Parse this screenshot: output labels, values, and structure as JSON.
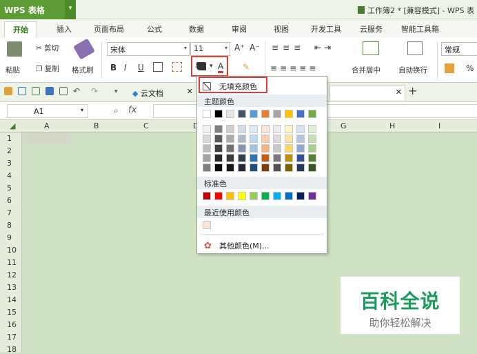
{
  "app": {
    "name": "WPS 表格",
    "doc_title": "工作簿2 * [兼容模式] - WPS 表"
  },
  "tabs": [
    "开始",
    "插入",
    "页面布局",
    "公式",
    "数据",
    "审阅",
    "视图",
    "开发工具",
    "云服务",
    "智能工具箱"
  ],
  "ribbon": {
    "paste": "粘贴",
    "cut": "剪切",
    "copy": "复制",
    "format_painter": "格式刷",
    "font_name": "宋体",
    "font_size": "11",
    "bold": "B",
    "italic": "I",
    "underline": "U",
    "grow_font": "A⁺",
    "shrink_font": "A⁻",
    "merge_center": "合并居中",
    "wrap_text": "自动换行",
    "number_format": "常规",
    "percent": "%"
  },
  "qat": {
    "tab_name": "云文档"
  },
  "formula": {
    "cell_ref": "A1",
    "fx": "fx"
  },
  "columns": [
    "A",
    "B",
    "C",
    "D",
    "E",
    "F",
    "G",
    "H",
    "I"
  ],
  "rows": [
    "1",
    "2",
    "3",
    "4",
    "5",
    "6",
    "7",
    "8",
    "9",
    "10",
    "11",
    "12",
    "13",
    "14",
    "15",
    "16",
    "17",
    "18"
  ],
  "fill_menu": {
    "no_fill": "无填充颜色",
    "theme_colors_label": "主题颜色",
    "standard_colors_label": "标准色",
    "recent_colors_label": "最近使用颜色",
    "more_colors": "其他颜色(M)...",
    "theme_top": [
      "#ffffff",
      "#000000",
      "#e7e6e6",
      "#44546a",
      "#5b9bd5",
      "#ed7d31",
      "#a5a5a5",
      "#ffc000",
      "#4472c4",
      "#70ad47"
    ],
    "theme_shades": [
      [
        "#f2f2f2",
        "#7f7f7f",
        "#d0cece",
        "#d6dce4",
        "#deebf6",
        "#fbe5d5",
        "#ededed",
        "#fff2cc",
        "#d9e2f3",
        "#e2efd9"
      ],
      [
        "#d8d8d8",
        "#595959",
        "#aeaaaa",
        "#adb9ca",
        "#bdd7ee",
        "#f7cbac",
        "#dbdbdb",
        "#fee599",
        "#b4c6e7",
        "#c5e0b3"
      ],
      [
        "#bfbfbf",
        "#3f3f3f",
        "#757070",
        "#8496b0",
        "#9dc3e6",
        "#f4b183",
        "#c9c9c9",
        "#ffd965",
        "#8eaadb",
        "#a8d08d"
      ],
      [
        "#a5a5a5",
        "#262626",
        "#3a3838",
        "#323f4f",
        "#2e75b5",
        "#c55a11",
        "#7b7b7b",
        "#bf9000",
        "#2f5496",
        "#538135"
      ],
      [
        "#7f7f7f",
        "#0c0c0c",
        "#171616",
        "#222a35",
        "#1e4e79",
        "#833c0b",
        "#525252",
        "#7f6000",
        "#1f3864",
        "#375623"
      ]
    ],
    "standard": [
      "#c00000",
      "#ff0000",
      "#ffc000",
      "#ffff00",
      "#92d050",
      "#00b050",
      "#00b0f0",
      "#0070c0",
      "#002060",
      "#7030a0"
    ],
    "recent": [
      "#fbe5d5"
    ]
  },
  "watermark": {
    "title": "百科全说",
    "subtitle": "助你轻松解决"
  },
  "colors": {
    "accent_green": "#5d9b34",
    "highlight_red": "#e23b3b",
    "sheet_bg": "#cfe2c4"
  }
}
